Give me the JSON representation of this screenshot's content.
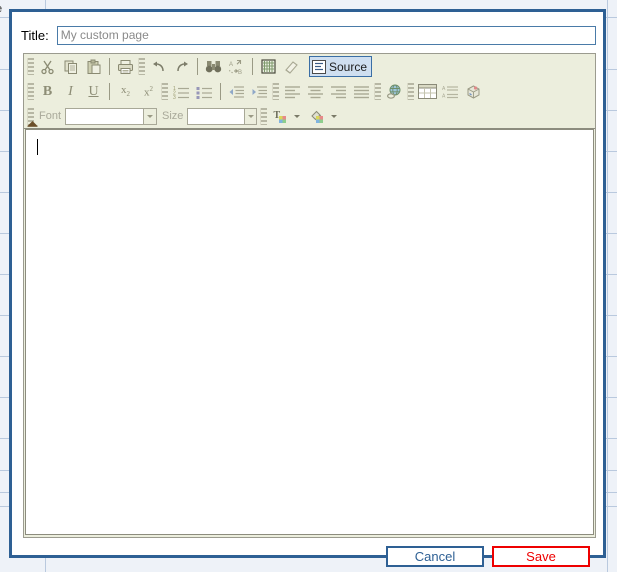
{
  "background": {
    "clipped_text": "e",
    "line_color": "#b9c9de",
    "fill_color": "#eef2f8"
  },
  "dialog": {
    "border_color": "#2e6094"
  },
  "title_field": {
    "label": "Title:",
    "value": "My custom page",
    "placeholder": "My custom page"
  },
  "editor": {
    "background": "#eceedd",
    "toolbar": {
      "row1": [
        {
          "name": "cut-icon",
          "label": "Cut",
          "active": false
        },
        {
          "name": "copy-icon",
          "label": "Copy",
          "active": false
        },
        {
          "name": "paste-icon",
          "label": "Paste",
          "active": false
        },
        {
          "name": "print-icon",
          "label": "Print",
          "active": false
        },
        {
          "name": "undo-icon",
          "label": "Undo",
          "active": false
        },
        {
          "name": "redo-icon",
          "label": "Redo",
          "active": false
        },
        {
          "name": "find-icon",
          "label": "Find",
          "active": false
        },
        {
          "name": "spellcheck-icon",
          "label": "Check Spelling",
          "active": false
        },
        {
          "name": "show-blocks-icon",
          "label": "Show Blocks",
          "active": false
        },
        {
          "name": "remove-format-icon",
          "label": "Remove Format",
          "active": false
        },
        {
          "name": "source-icon",
          "label": "Source",
          "active": true
        }
      ],
      "source_button_label": "Source",
      "row2": [
        {
          "name": "bold-icon",
          "label": "Bold",
          "glyph": "B"
        },
        {
          "name": "italic-icon",
          "label": "Italic",
          "glyph": "I"
        },
        {
          "name": "underline-icon",
          "label": "Underline",
          "glyph": "U"
        },
        {
          "name": "subscript-icon",
          "label": "Subscript",
          "glyph": "x"
        },
        {
          "name": "superscript-icon",
          "label": "Superscript",
          "glyph": "x"
        },
        {
          "name": "numbered-list-icon",
          "label": "Insert/Remove Numbered List"
        },
        {
          "name": "bulleted-list-icon",
          "label": "Insert/Remove Bulleted List"
        },
        {
          "name": "decrease-indent-icon",
          "label": "Decrease Indent"
        },
        {
          "name": "increase-indent-icon",
          "label": "Increase Indent"
        },
        {
          "name": "align-left-icon",
          "label": "Align Left"
        },
        {
          "name": "align-center-icon",
          "label": "Center"
        },
        {
          "name": "align-right-icon",
          "label": "Align Right"
        },
        {
          "name": "justify-icon",
          "label": "Justify"
        },
        {
          "name": "link-icon",
          "label": "Link"
        },
        {
          "name": "table-icon",
          "label": "Table"
        },
        {
          "name": "horizontal-rule-icon",
          "label": "Horizontal Line"
        },
        {
          "name": "smiley-icon",
          "label": "Insert Special Character"
        }
      ],
      "row3": {
        "font_label": "Font",
        "font_value": "",
        "size_label": "Size",
        "size_value": "",
        "text_color_label": "Text Color",
        "bg_color_label": "Background Color"
      }
    },
    "content": {
      "text": ""
    }
  },
  "footer": {
    "cancel_label": "Cancel",
    "save_label": "Save",
    "cancel_color": "#2e6094",
    "save_color": "#ee0000"
  }
}
